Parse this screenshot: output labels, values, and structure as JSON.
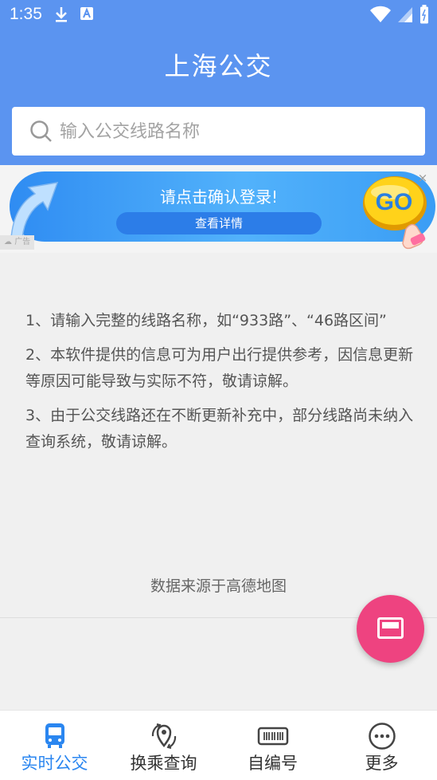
{
  "status_bar": {
    "time": "1:35"
  },
  "app": {
    "title": "上海公交"
  },
  "search": {
    "placeholder": "输入公交线路名称"
  },
  "ad": {
    "title": "请点击确认登录!",
    "detail_button": "查看详情",
    "go_text": "GO",
    "close": "×",
    "label": "广告"
  },
  "tips": [
    "1、请输入完整的线路名称，如“933路”、“46路区间”",
    "2、本软件提供的信息可为用户出行提供参考，因信息更新等原因可能导致与实际不符，敬请谅解。",
    "3、由于公交线路还在不断更新补充中，部分线路尚未纳入查询系统，敬请谅解。"
  ],
  "source": "数据来源于高德地图",
  "nav": {
    "items": [
      {
        "label": "实时公交",
        "icon": "bus-icon",
        "active": true
      },
      {
        "label": "换乘查询",
        "icon": "transfer-location-icon",
        "active": false
      },
      {
        "label": "自编号",
        "icon": "barcode-icon",
        "active": false
      },
      {
        "label": "更多",
        "icon": "more-dots-icon",
        "active": false
      }
    ]
  },
  "colors": {
    "header": "#5b94f0",
    "accent": "#2a86f0",
    "fab": "#ee4380",
    "background": "#f0f0f0"
  }
}
